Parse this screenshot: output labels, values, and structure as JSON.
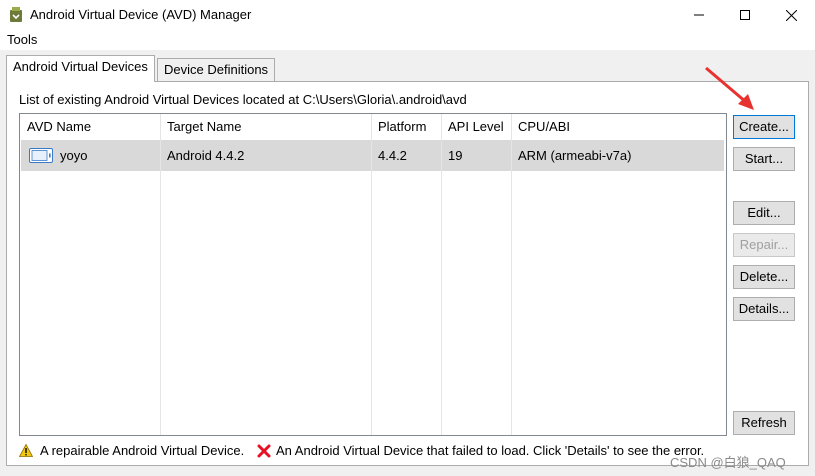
{
  "window": {
    "title": "Android Virtual Device (AVD) Manager",
    "controls": {
      "minimize": "minimize-icon",
      "maximize": "maximize-icon",
      "close": "close-icon"
    }
  },
  "menu": {
    "tools": "Tools"
  },
  "tabs": [
    {
      "label": "Android Virtual Devices",
      "active": true
    },
    {
      "label": "Device Definitions",
      "active": false
    }
  ],
  "list_caption": "List of existing Android Virtual Devices located at C:\\Users\\Gloria\\.android\\avd",
  "table": {
    "headers": [
      "AVD Name",
      "Target Name",
      "Platform",
      "API Level",
      "CPU/ABI"
    ],
    "rows": [
      {
        "avd_name": "yoyo",
        "target_name": "Android 4.4.2",
        "platform": "4.4.2",
        "api_level": "19",
        "cpu_abi": "ARM (armeabi-v7a)",
        "selected": true
      }
    ]
  },
  "buttons": {
    "create": "Create...",
    "start": "Start...",
    "edit": "Edit...",
    "repair": "Repair...",
    "delete": "Delete...",
    "details": "Details...",
    "refresh": "Refresh"
  },
  "footer": {
    "warning_text": "A repairable Android Virtual Device.",
    "error_text": "An Android Virtual Device that failed to load. Click 'Details' to see the error."
  },
  "watermark": "CSDN @白狼_QAQ",
  "colors": {
    "selected_row": "#d9d9d9",
    "accent_border": "#0078d7",
    "annotation_arrow": "#e8322f",
    "warning": "#f2c811",
    "error": "#e81123"
  }
}
